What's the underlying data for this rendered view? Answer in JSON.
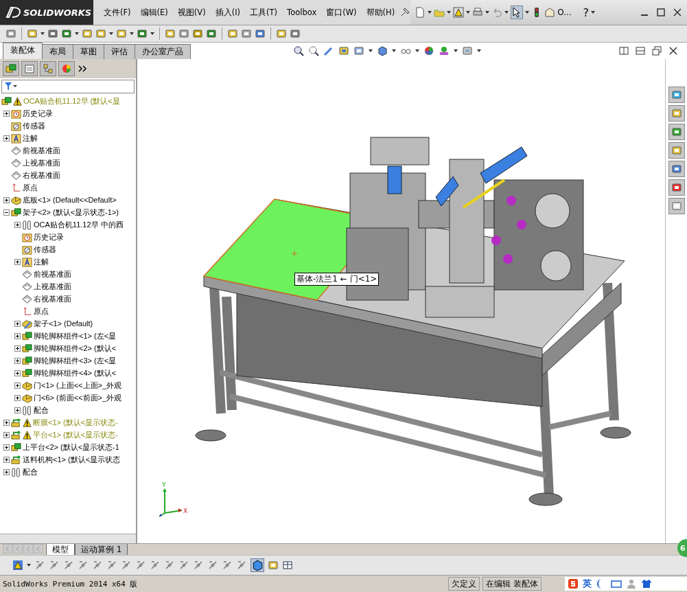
{
  "app": {
    "logo": "SOLIDWORKS",
    "help": "?",
    "quick_access_text": "O..."
  },
  "menus": [
    "文件(F)",
    "编辑(E)",
    "视图(V)",
    "插入(I)",
    "工具(T)",
    "Toolbox",
    "窗口(W)",
    "帮助(H)"
  ],
  "command_tabs": [
    {
      "label": "装配体",
      "selected": true
    },
    {
      "label": "布局",
      "selected": false
    },
    {
      "label": "草图",
      "selected": false
    },
    {
      "label": "评估",
      "selected": false
    },
    {
      "label": "办公室产品",
      "selected": false
    }
  ],
  "feature_manager": {
    "tree": [
      {
        "label": "OCA贴合机11.12早  (默认<显",
        "kind": "assembly",
        "warning": true,
        "children": [
          {
            "label": "历史记录",
            "kind": "history",
            "warning": false,
            "expanded": false
          },
          {
            "label": "传感器",
            "kind": "sensor",
            "warning": false
          },
          {
            "label": "注解",
            "kind": "annotation",
            "warning": false,
            "expanded": false
          },
          {
            "label": "前视基准面",
            "kind": "plane",
            "warning": false
          },
          {
            "label": "上视基准面",
            "kind": "plane",
            "warning": false
          },
          {
            "label": "右视基准面",
            "kind": "plane",
            "warning": false
          },
          {
            "label": "原点",
            "kind": "origin",
            "warning": false
          },
          {
            "label": "底板<1> (Default<<Default>",
            "kind": "part",
            "warning": false,
            "expanded": false
          },
          {
            "label": "架子<2> (默认<显示状态-1>)",
            "kind": "assembly",
            "warning": false,
            "expanded": true,
            "children": [
              {
                "label": "OCA贴合机11.12早 中的酉",
                "kind": "mates",
                "warning": false,
                "expanded": false
              },
              {
                "label": "历史记录",
                "kind": "history",
                "warning": false
              },
              {
                "label": "传感器",
                "kind": "sensor",
                "warning": false
              },
              {
                "label": "注解",
                "kind": "annotation",
                "warning": false,
                "expanded": false
              },
              {
                "label": "前视基准面",
                "kind": "plane",
                "warning": false
              },
              {
                "label": "上视基准面",
                "kind": "plane",
                "warning": false
              },
              {
                "label": "右视基准面",
                "kind": "plane",
                "warning": false
              },
              {
                "label": "原点",
                "kind": "origin",
                "warning": false
              },
              {
                "label": "架子<1> (Default)",
                "kind": "part-edit",
                "warning": false,
                "expanded": false
              },
              {
                "label": "脚轮脚杯组件<1> (左<显",
                "kind": "assembly",
                "warning": false,
                "expanded": false
              },
              {
                "label": "脚轮脚杯组件<2> (默认<",
                "kind": "assembly",
                "warning": false,
                "expanded": false
              },
              {
                "label": "脚轮脚杯组件<3> (左<显",
                "kind": "assembly",
                "warning": false,
                "expanded": false
              },
              {
                "label": "脚轮脚杯组件<4> (默认<",
                "kind": "assembly",
                "warning": false,
                "expanded": false
              },
              {
                "label": "门<1> (上面<<上面>_外观",
                "kind": "part",
                "warning": false,
                "expanded": false
              },
              {
                "label": "门<6> (前面<<前面>_外观",
                "kind": "part",
                "warning": false,
                "expanded": false
              },
              {
                "label": "配合",
                "kind": "mates",
                "warning": false,
                "expanded": false
              }
            ]
          },
          {
            "label": "断膜<1> (默认<显示状态-",
            "kind": "flex",
            "warning": true,
            "expanded": false
          },
          {
            "label": "平台<1> (默认<显示状态-",
            "kind": "flex",
            "warning": true,
            "expanded": false
          },
          {
            "label": "上平台<2> (默认<显示状态-1",
            "kind": "assembly",
            "warning": false,
            "expanded": false
          },
          {
            "label": "送料机构<1> (默认<显示状态",
            "kind": "flex",
            "warning": false,
            "expanded": false
          },
          {
            "label": "配合",
            "kind": "mates",
            "warning": false,
            "expanded": false
          }
        ]
      }
    ]
  },
  "viewport": {
    "tooltip": "基体-法兰1 ← 门<1>",
    "triad": [
      "Y",
      "X"
    ]
  },
  "bottom_tabs": [
    {
      "label": "模型",
      "selected": true
    },
    {
      "label": "运动算例 1",
      "selected": false
    }
  ],
  "notification_badge": "6",
  "status_bar": {
    "product": "SolidWorks Premium 2014 x64 版",
    "sketch_state": "欠定义",
    "edit_state": "在编辑 装配体",
    "ime_mode": "英"
  }
}
